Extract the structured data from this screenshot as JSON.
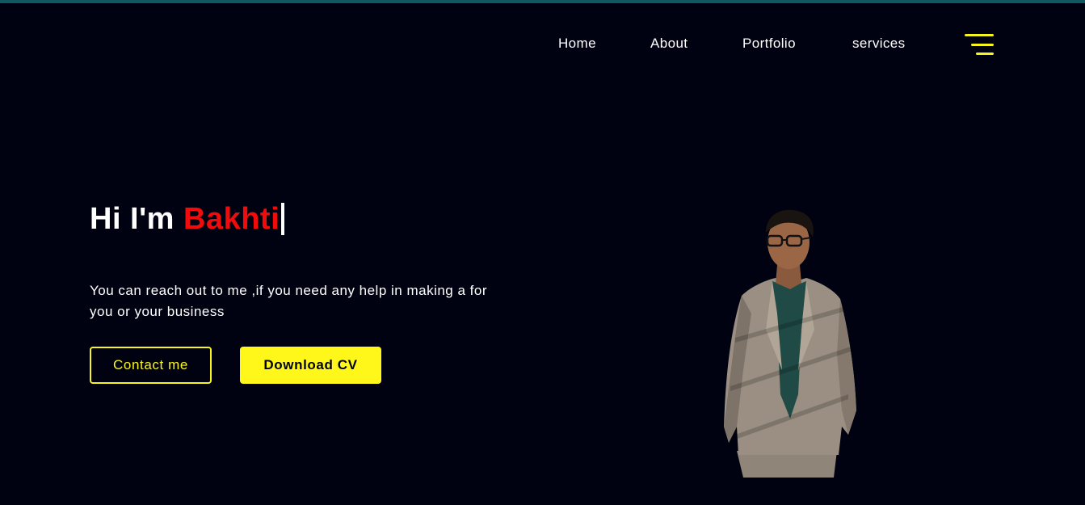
{
  "nav": {
    "items": [
      {
        "label": "Home"
      },
      {
        "label": "About"
      },
      {
        "label": "Portfolio"
      },
      {
        "label": "services"
      }
    ],
    "menu_icon": "hamburger-menu-icon"
  },
  "hero": {
    "greeting": "Hi I'm ",
    "name": "Bakhti",
    "description": "You can reach out to me ,if you need any help in making a for you or your business",
    "buttons": {
      "contact_label": "Contact me",
      "download_label": "Download CV"
    }
  },
  "colors": {
    "background": "#000212",
    "accent": "#f8f51c",
    "name_highlight": "#f20b0b",
    "top_strip": "#0f5961"
  }
}
